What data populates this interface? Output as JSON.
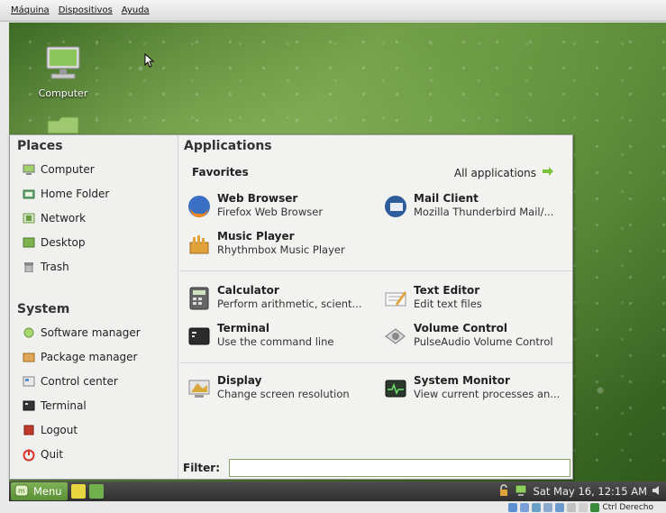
{
  "vbox_menu": [
    "Máquina",
    "Dispositivos",
    "Ayuda"
  ],
  "desktop": {
    "icons": [
      {
        "label": "Computer",
        "icon": "computer-icon"
      },
      {
        "label": "",
        "icon": "home-folder-icon"
      }
    ]
  },
  "menu": {
    "places_title": "Places",
    "places": [
      {
        "label": "Computer",
        "icon": "computer-icon"
      },
      {
        "label": "Home Folder",
        "icon": "home-folder-icon"
      },
      {
        "label": "Network",
        "icon": "network-icon"
      },
      {
        "label": "Desktop",
        "icon": "desktop-icon"
      },
      {
        "label": "Trash",
        "icon": "trash-icon"
      }
    ],
    "system_title": "System",
    "system": [
      {
        "label": "Software manager",
        "icon": "software-manager-icon"
      },
      {
        "label": "Package manager",
        "icon": "package-manager-icon"
      },
      {
        "label": "Control center",
        "icon": "control-center-icon"
      },
      {
        "label": "Terminal",
        "icon": "terminal-icon"
      },
      {
        "label": "Logout",
        "icon": "logout-icon"
      },
      {
        "label": "Quit",
        "icon": "quit-icon"
      }
    ],
    "applications_title": "Applications",
    "favorites_label": "Favorites",
    "all_applications_label": "All applications",
    "apps": [
      {
        "name": "Web Browser",
        "desc": "Firefox Web Browser",
        "icon": "firefox-icon"
      },
      {
        "name": "Mail Client",
        "desc": "Mozilla Thunderbird Mail/...",
        "icon": "thunderbird-icon"
      },
      {
        "name": "Music Player",
        "desc": "Rhythmbox Music Player",
        "icon": "rhythmbox-icon"
      },
      {
        "name": "Calculator",
        "desc": "Perform arithmetic, scient...",
        "icon": "calculator-icon"
      },
      {
        "name": "Text Editor",
        "desc": "Edit text files",
        "icon": "text-editor-icon"
      },
      {
        "name": "Terminal",
        "desc": "Use the command line",
        "icon": "terminal-icon"
      },
      {
        "name": "Volume Control",
        "desc": "PulseAudio Volume Control",
        "icon": "volume-control-icon"
      },
      {
        "name": "Display",
        "desc": "Change screen resolution",
        "icon": "display-icon"
      },
      {
        "name": "System Monitor",
        "desc": "View current processes an...",
        "icon": "system-monitor-icon"
      }
    ],
    "filter_label": "Filter:",
    "filter_value": ""
  },
  "panel": {
    "menu_label": "Menu",
    "clock": "Sat May 16, 12:15 AM"
  },
  "host_tray": {
    "host_key_label": "Ctrl Derecho"
  },
  "colors": {
    "accent_green": "#6aa03f",
    "panel_dark": "#3a3a3a",
    "menu_bg": "#f2f2f0"
  }
}
